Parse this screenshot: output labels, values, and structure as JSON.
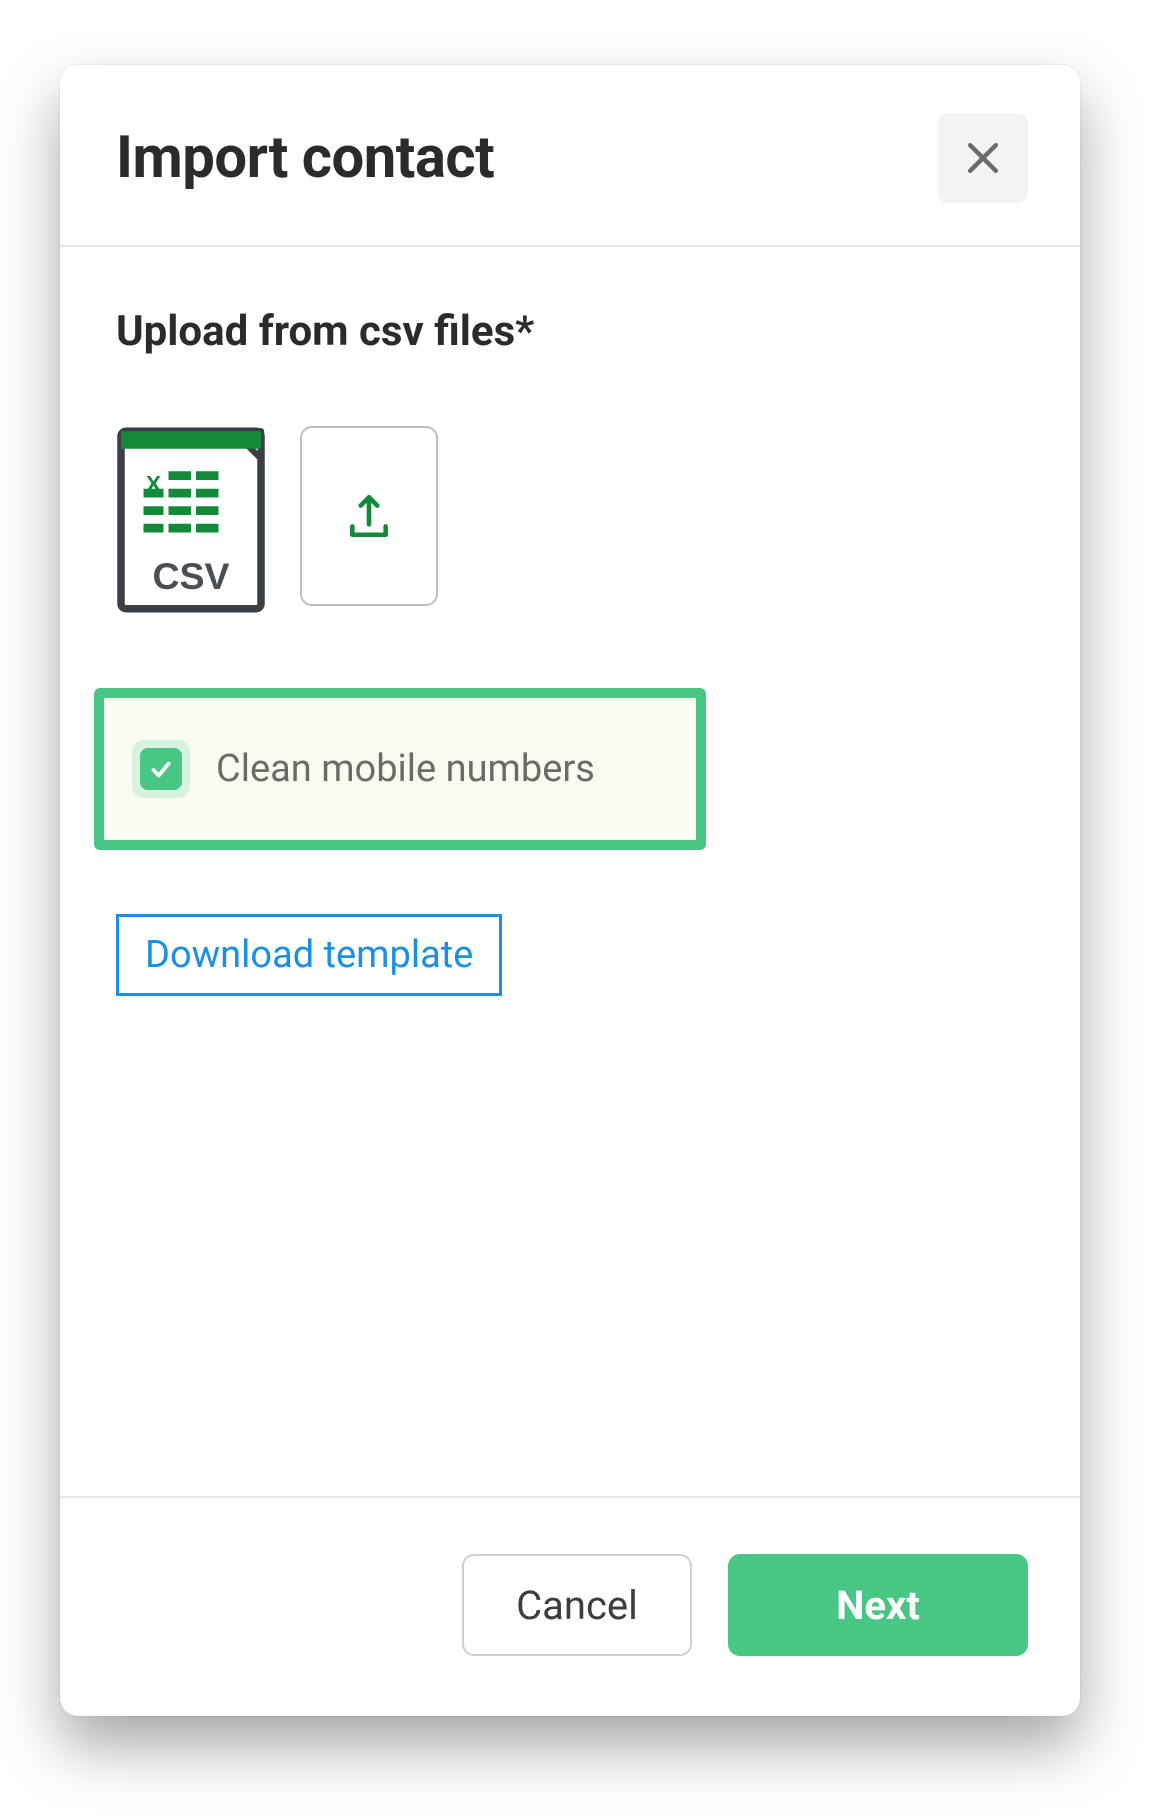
{
  "colors": {
    "accent": "#48c684",
    "link": "#1a8fe3"
  },
  "modal": {
    "title": "Import contact",
    "section_label": "Upload from csv files*",
    "csv_icon_label": "CSV",
    "clean_numbers": {
      "checked": true,
      "label": "Clean mobile numbers"
    },
    "download_template_label": "Download template",
    "footer": {
      "cancel": "Cancel",
      "next": "Next"
    }
  }
}
